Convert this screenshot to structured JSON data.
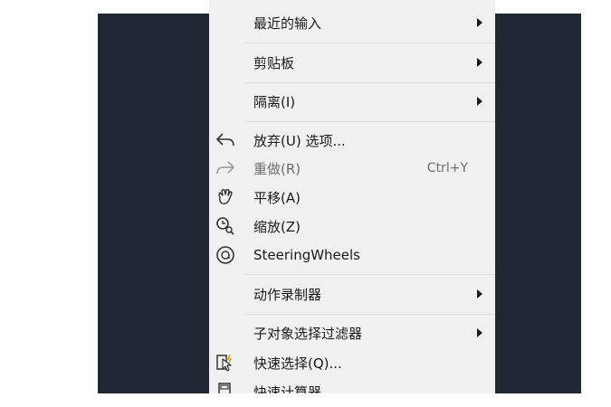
{
  "context_menu": {
    "items": [
      {
        "label": "最近的输入",
        "submenu": true
      },
      {
        "label": "剪贴板",
        "submenu": true
      },
      {
        "label": "隔离(I)",
        "submenu": true
      },
      {
        "label": "放弃(U) 选项...",
        "icon": "undo-icon"
      },
      {
        "label": "重做(R)",
        "shortcut": "Ctrl+Y",
        "icon": "redo-icon",
        "disabled": true
      },
      {
        "label": "平移(A)",
        "icon": "pan-hand-icon"
      },
      {
        "label": "缩放(Z)",
        "icon": "zoom-icon"
      },
      {
        "label": "SteeringWheels",
        "icon": "steering-wheel-icon"
      },
      {
        "label": "动作录制器",
        "submenu": true
      },
      {
        "label": "子对象选择过滤器",
        "submenu": true
      },
      {
        "label": "快速选择(Q)...",
        "icon": "quick-select-icon"
      },
      {
        "label": "快速计算器",
        "icon": "calculator-icon"
      }
    ]
  }
}
